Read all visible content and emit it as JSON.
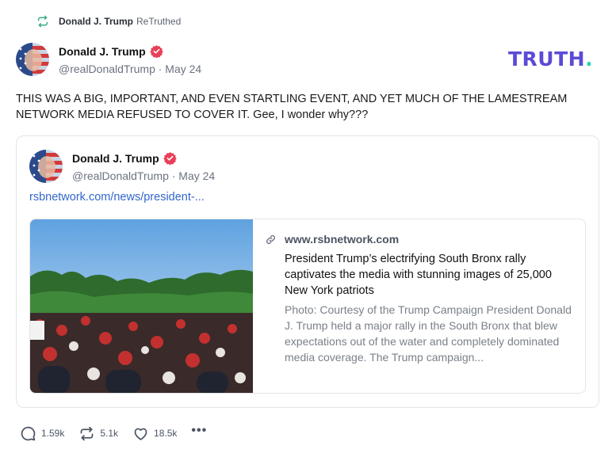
{
  "retruth": {
    "user": "Donald J. Trump",
    "label": "ReTruthed"
  },
  "post": {
    "author": {
      "display_name": "Donald J. Trump",
      "handle_date": "@realDonaldTrump · May 24",
      "verified_icon": "verified-badge-icon"
    },
    "text": "THIS WAS A BIG, IMPORTANT, AND EVEN STARTLING EVENT, AND YET MUCH OF THE LAMESTREAM NETWORK MEDIA REFUSED TO COVER IT. Gee, I wonder why???"
  },
  "brand": {
    "logo_text": "TRUTH",
    "logo_dot": ".",
    "colors": {
      "logo": "#5b4bd6",
      "logo_dot": "#2bd1b8",
      "verified": "#e8405a",
      "link": "#3366cc"
    }
  },
  "quote": {
    "author": {
      "display_name": "Donald J. Trump",
      "handle_date": "@realDonaldTrump · May 24"
    },
    "link_text": "rsbnetwork.com/news/president-...",
    "link_card": {
      "domain": "www.rsbnetwork.com",
      "title": "President Trump’s electrifying South Bronx rally captivates the media with stunning images of 25,000 New York patriots",
      "description": "Photo: Courtesy of the Trump Campaign President Donald J. Trump held a major rally in the South Bronx that blew expectations out of the water and completely dominated media coverage. The Trump campaign...",
      "image_alt": "rally-crowd-photo"
    }
  },
  "actions": {
    "replies": "1.59k",
    "retruths": "5.1k",
    "likes": "18.5k",
    "more": "•••"
  }
}
